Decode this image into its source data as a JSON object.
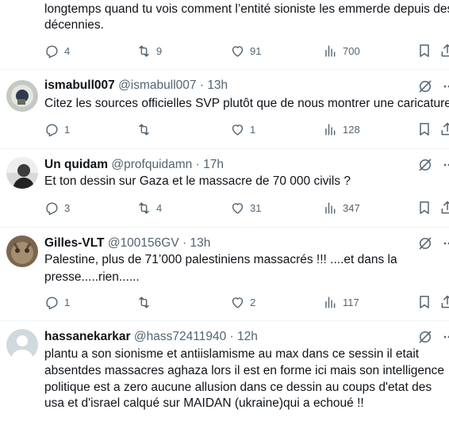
{
  "tweets": [
    {
      "lines": [
        "longtemps quand tu vois comment l’entité sioniste les emmerde depuis des",
        "décennies."
      ],
      "replies": "4",
      "reposts": "9",
      "likes": "91",
      "views": "700"
    },
    {
      "name": "ismabull007",
      "handle": "@ismabull007",
      "time": "13h",
      "lines": [
        "Citez les sources officielles SVP plutôt que de nous montrer une caricature"
      ],
      "replies": "1",
      "reposts": "",
      "likes": "1",
      "views": "128"
    },
    {
      "name": "Un quidam",
      "handle": "@profquidamn",
      "time": "17h",
      "lines": [
        "Et ton dessin sur Gaza et le massacre de 70 000 civils ?"
      ],
      "replies": "3",
      "reposts": "4",
      "likes": "31",
      "views": "347"
    },
    {
      "name": "Gilles-VLT",
      "handle": "@100156GV",
      "time": "13h",
      "lines": [
        "Palestine, plus de 71’000 palestiniens massacrés !!! ....et dans la",
        "presse.....rien......"
      ],
      "replies": "1",
      "reposts": "",
      "likes": "2",
      "views": "117"
    },
    {
      "name": "hassanekarkar",
      "handle": "@hass72411940",
      "time": "12h",
      "lines": [
        "plantu a son sionisme et antiislamisme au max dans ce sessin   il etait",
        "absentdes massacres aghaza  lors il est en forme ici mais son intelligence",
        "politique est a zero  aucune allusion  dans ce dessin au coups d'etat des",
        "usa et d'israel calqué sur MAIDAN (ukraine)qui a echoué !!"
      ]
    }
  ],
  "separator": "·",
  "icons": {
    "reply": "reply-icon",
    "repost": "repost-icon",
    "like": "heart-icon",
    "views": "views-icon",
    "bookmark": "bookmark-icon",
    "share": "share-icon",
    "grok": "grok-icon",
    "more": "more-icon"
  }
}
